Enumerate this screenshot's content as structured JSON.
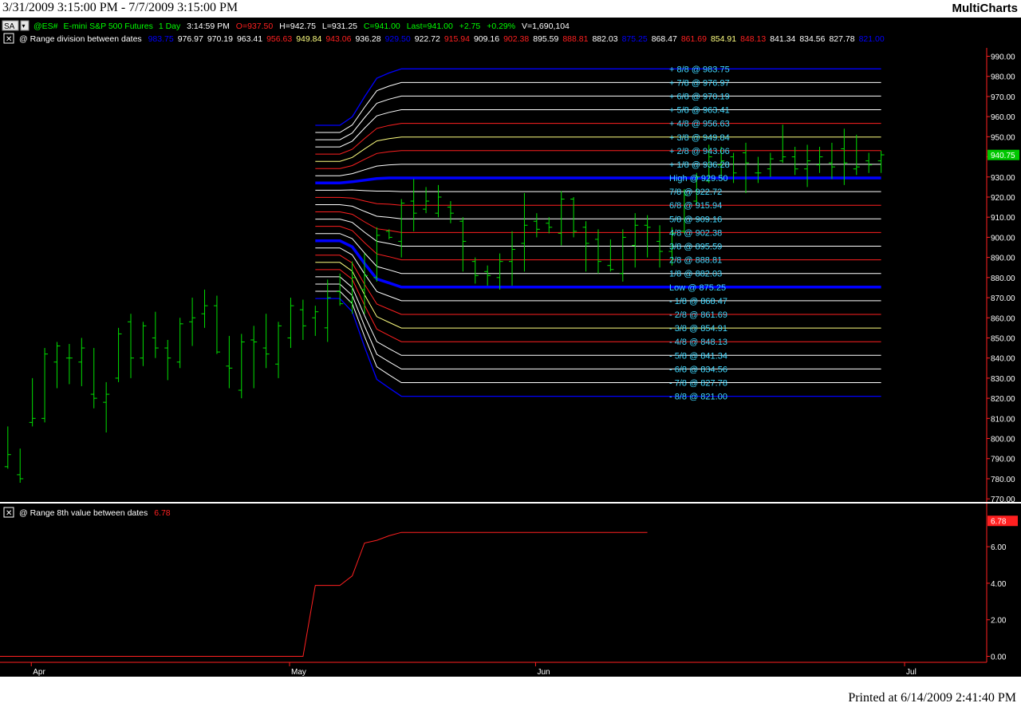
{
  "header": {
    "date_range": "3/31/2009 3:15:00 PM - 7/7/2009 3:15:00 PM",
    "brand": "MultiCharts"
  },
  "footer": {
    "printed": "Printed at 6/14/2009 2:41:40 PM"
  },
  "toolbar": {
    "sa_label": "SA",
    "close_glyph": "✕"
  },
  "instrument": {
    "symbol": "@ES#",
    "name": "E-mini S&P 500 Futures",
    "interval": "1 Day",
    "time": "3:14:59 PM",
    "open": "O=937.50",
    "high": "H=942.75",
    "low": "L=931.25",
    "close": "C=941.00",
    "last": "Last=941.00",
    "change": "+2.75",
    "change_pct": "+0.29%",
    "volume": "V=1,690,104"
  },
  "indicator1": {
    "name": "@ Range division between dates",
    "values": [
      {
        "text": "983.75",
        "color": "#0000ff"
      },
      {
        "text": "976.97",
        "color": "#ffffff"
      },
      {
        "text": "970.19",
        "color": "#ffffff"
      },
      {
        "text": "963.41",
        "color": "#ffffff"
      },
      {
        "text": "956.63",
        "color": "#ff2020"
      },
      {
        "text": "949.84",
        "color": "#ffff80"
      },
      {
        "text": "943.06",
        "color": "#ff2020"
      },
      {
        "text": "936.28",
        "color": "#ffffff"
      },
      {
        "text": "929.50",
        "color": "#0000ff"
      },
      {
        "text": "922.72",
        "color": "#ffffff"
      },
      {
        "text": "915.94",
        "color": "#ff2020"
      },
      {
        "text": "909.16",
        "color": "#ffffff"
      },
      {
        "text": "902.38",
        "color": "#ff2020"
      },
      {
        "text": "895.59",
        "color": "#ffffff"
      },
      {
        "text": "888.81",
        "color": "#ff2020"
      },
      {
        "text": "882.03",
        "color": "#ffffff"
      },
      {
        "text": "875.25",
        "color": "#0000ff"
      },
      {
        "text": "868.47",
        "color": "#ffffff"
      },
      {
        "text": "861.69",
        "color": "#ff2020"
      },
      {
        "text": "854.91",
        "color": "#ffff80"
      },
      {
        "text": "848.13",
        "color": "#ff2020"
      },
      {
        "text": "841.34",
        "color": "#ffffff"
      },
      {
        "text": "834.56",
        "color": "#ffffff"
      },
      {
        "text": "827.78",
        "color": "#ffffff"
      },
      {
        "text": "821.00",
        "color": "#0000ff"
      }
    ]
  },
  "indicator2": {
    "name": "@ Range 8th value between dates",
    "value": "6.78",
    "value_color": "#ff2020"
  },
  "colors": {
    "background": "#000000",
    "bars": "#00e000",
    "axis_text": "#ffffff",
    "label_text": "#40d8ff",
    "blue": "#0000ff",
    "red": "#ff2020",
    "white": "#ffffff",
    "yellow": "#ffff80",
    "last_box": "#00c800"
  },
  "chart_data": [
    {
      "type": "bar",
      "title": "@ES# E-mini S&P 500 Futures 1 Day",
      "ylim": [
        770,
        995
      ],
      "y_ticks": [
        "990.00",
        "980.00",
        "970.00",
        "960.00",
        "950.00",
        "940.00",
        "930.00",
        "920.00",
        "910.00",
        "900.00",
        "890.00",
        "880.00",
        "870.00",
        "860.00",
        "850.00",
        "840.00",
        "830.00",
        "820.00",
        "810.00",
        "800.00",
        "790.00",
        "780.00",
        "770.00"
      ],
      "x_labels": [
        {
          "label": "Apr",
          "index": 1
        },
        {
          "label": "May",
          "index": 22
        },
        {
          "label": "Jun",
          "index": 42
        },
        {
          "label": "Jul",
          "index": 72
        }
      ],
      "last_value": "940.75",
      "series": [
        {
          "ohlc": [
            [
              786,
              806,
              785,
              792
            ],
            [
              782,
              795,
              778,
              780
            ],
            [
              808,
              830,
              806,
              810
            ],
            [
              810,
              845,
              808,
              842
            ],
            [
              838,
              848,
              825,
              846
            ],
            [
              840,
              847,
              827,
              840
            ],
            [
              838,
              850,
              826,
              845
            ],
            [
              822,
              845,
              815,
              820
            ],
            [
              818,
              828,
              803,
              822
            ],
            [
              830,
              855,
              828,
              852
            ],
            [
              858,
              862,
              830,
              840
            ],
            [
              840,
              858,
              836,
              856
            ],
            [
              850,
              863,
              840,
              845
            ],
            [
              845,
              849,
              829,
              840
            ],
            [
              838,
              860,
              835,
              857
            ],
            [
              858,
              870,
              846,
              860
            ],
            [
              862,
              874,
              855,
              866
            ],
            [
              866,
              871,
              842,
              843
            ],
            [
              836,
              851,
              825,
              835
            ],
            [
              824,
              852,
              820,
              848
            ],
            [
              849,
              856,
              825,
              848
            ],
            [
              845,
              862,
              835,
              842
            ],
            [
              837,
              858,
              830,
              856
            ],
            [
              850,
              870,
              845,
              866
            ],
            [
              864,
              869,
              849,
              856
            ],
            [
              860,
              866,
              851,
              863
            ],
            [
              855,
              879,
              848,
              870
            ],
            [
              873,
              882,
              866,
              867
            ],
            [
              868,
              888,
              862,
              880
            ],
            [
              874,
              892,
              862,
              881
            ],
            [
              880,
              905,
              878,
              901
            ],
            [
              903,
              904,
              899,
              900
            ],
            [
              898,
              919,
              890,
              917
            ],
            [
              918,
              929,
              903,
              912
            ],
            [
              914,
              925,
              912,
              918
            ],
            [
              912,
              926,
              910,
              920
            ],
            [
              915,
              918,
              907,
              912
            ],
            [
              908,
              910,
              883,
              898
            ],
            [
              888,
              890,
              877,
              881
            ],
            [
              883,
              886,
              876,
              881
            ],
            [
              880,
              892,
              874,
              888
            ],
            [
              888,
              903,
              876,
              894
            ],
            [
              897,
              922,
              883,
              906
            ],
            [
              908,
              912,
              900,
              904
            ],
            [
              907,
              910,
              902,
              905
            ],
            [
              902,
              923,
              896,
              919
            ],
            [
              919,
              920,
              900,
              903
            ],
            [
              905,
              908,
              883,
              897
            ],
            [
              899,
              904,
              882,
              888
            ],
            [
              886,
              899,
              883,
              884
            ],
            [
              882,
              904,
              878,
              900
            ],
            [
              896,
              912,
              885,
              906
            ],
            [
              906,
              911,
              890,
              905
            ],
            [
              898,
              906,
              885,
              893
            ],
            [
              893,
              905,
              886,
              902
            ],
            [
              903,
              924,
              902,
              921
            ],
            [
              918,
              932,
              916,
              930
            ],
            [
              928,
              946,
              927,
              940
            ],
            [
              936,
              945,
              929,
              938
            ],
            [
              940,
              942,
              927,
              932
            ],
            [
              942,
              947,
              922,
              937
            ],
            [
              932,
              940,
              927,
              932
            ],
            [
              934,
              942,
              930,
              939
            ],
            [
              938,
              956,
              937,
              940
            ],
            [
              940,
              945,
              931,
              934
            ],
            [
              934,
              946,
              925,
              938
            ],
            [
              936,
              945,
              932,
              940
            ],
            [
              937,
              947,
              929,
              935
            ],
            [
              944,
              954,
              926,
              937
            ],
            [
              934,
              951,
              931,
              935
            ],
            [
              938,
              942,
              932,
              936
            ],
            [
              938,
              943,
              932,
              941
            ]
          ]
        }
      ]
    },
    {
      "type": "line",
      "title": "@ Range 8th value between dates",
      "ylim": [
        0,
        7.8
      ],
      "y_ticks": [
        "6.00",
        "4.00",
        "2.00",
        "0.00"
      ],
      "last_value": "6.78",
      "series": [
        {
          "name": "Range 8th value",
          "values": [
            0,
            0,
            0,
            0,
            0,
            0,
            0,
            0,
            0,
            0,
            0,
            0,
            0,
            0,
            0,
            0,
            0,
            0,
            0,
            0,
            0,
            0,
            0,
            0,
            0,
            3.88,
            3.88,
            3.88,
            4.4,
            6.2,
            6.35,
            6.6,
            6.78,
            6.78,
            6.78,
            6.78,
            6.78,
            6.78,
            6.78,
            6.78,
            6.78,
            6.78,
            6.78,
            6.78,
            6.78,
            6.78,
            6.78,
            6.78,
            6.78,
            6.78,
            6.78,
            6.78,
            6.78
          ]
        }
      ]
    }
  ],
  "division_levels": [
    {
      "label": "+ 8/8 @ 983.75",
      "value": 983.75,
      "color": "#0000ff",
      "width": 1.3
    },
    {
      "label": "+ 7/8 @ 976.97",
      "value": 976.97,
      "color": "#ffffff",
      "width": 1
    },
    {
      "label": "+ 6/8 @ 970.19",
      "value": 970.19,
      "color": "#ffffff",
      "width": 1
    },
    {
      "label": "+ 5/8 @ 963.41",
      "value": 963.41,
      "color": "#ffffff",
      "width": 1
    },
    {
      "label": "+ 4/8 @ 956.63",
      "value": 956.63,
      "color": "#ff2020",
      "width": 1
    },
    {
      "label": "+ 3/8 @ 949.84",
      "value": 949.84,
      "color": "#ffff80",
      "width": 1
    },
    {
      "label": "+ 2/8 @ 943.06",
      "value": 943.06,
      "color": "#ff2020",
      "width": 1
    },
    {
      "label": "+ 1/8 @ 936.28",
      "value": 936.28,
      "color": "#ffffff",
      "width": 1
    },
    {
      "label": "High @ 929.50",
      "value": 929.5,
      "color": "#0000ff",
      "width": 3.5
    },
    {
      "label": "7/8 @ 922.72",
      "value": 922.72,
      "color": "#ffffff",
      "width": 1
    },
    {
      "label": "6/8 @ 915.94",
      "value": 915.94,
      "color": "#ff2020",
      "width": 1
    },
    {
      "label": "5/8 @ 909.16",
      "value": 909.16,
      "color": "#ffffff",
      "width": 1
    },
    {
      "label": "4/8 @ 902.38",
      "value": 902.38,
      "color": "#ff2020",
      "width": 1
    },
    {
      "label": "3/8 @ 895.59",
      "value": 895.59,
      "color": "#ffffff",
      "width": 1
    },
    {
      "label": "2/8 @ 888.81",
      "value": 888.81,
      "color": "#ff2020",
      "width": 1
    },
    {
      "label": "1/8 @ 882.03",
      "value": 882.03,
      "color": "#ffffff",
      "width": 1
    },
    {
      "label": "Low  @ 875.25",
      "value": 875.25,
      "color": "#0000ff",
      "width": 3.5
    },
    {
      "label": "- 1/8 @ 868.47",
      "value": 868.47,
      "color": "#ffffff",
      "width": 1
    },
    {
      "label": "- 2/8 @ 861.69",
      "value": 861.69,
      "color": "#ff2020",
      "width": 1
    },
    {
      "label": "- 3/8 @ 854.91",
      "value": 854.91,
      "color": "#ffff80",
      "width": 1
    },
    {
      "label": "- 4/8 @ 848.13",
      "value": 848.13,
      "color": "#ff2020",
      "width": 1
    },
    {
      "label": "- 5/8 @ 841.34",
      "value": 841.34,
      "color": "#ffffff",
      "width": 1
    },
    {
      "label": "- 6/8 @ 834.56",
      "value": 834.56,
      "color": "#ffffff",
      "width": 1
    },
    {
      "label": "- 7/8 @ 827.78",
      "value": 827.78,
      "color": "#ffffff",
      "width": 1
    },
    {
      "label": "- 8/8 @ 821.00",
      "value": 821.0,
      "color": "#0000ff",
      "width": 1.3
    }
  ],
  "division_profile": {
    "start_index": 25,
    "high_path": [
      927,
      927,
      927,
      927.6,
      928.4,
      929.2,
      929.5,
      929.5,
      929.5,
      929.5
    ],
    "low_path": [
      898.3,
      898.3,
      898.3,
      895.3,
      887,
      879.3,
      877.3,
      875.25,
      875.25,
      875.25
    ]
  }
}
